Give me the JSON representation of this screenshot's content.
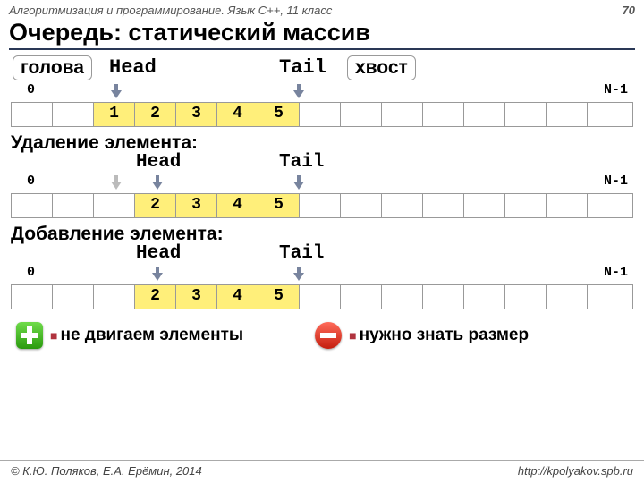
{
  "header": {
    "course": "Алгоритмизация и программирование. Язык C++, 11 класс",
    "page": "70"
  },
  "title": "Очередь: статический массив",
  "labels": {
    "head_ru": "голова",
    "head": "Head",
    "tail": "Tail",
    "tail_ru": "хвост",
    "zero": "0",
    "n1": "N-1"
  },
  "sections": {
    "del": "Удаление элемента:",
    "add": "Добавление элемента:"
  },
  "arrays": {
    "a1": [
      "",
      "",
      "1",
      "2",
      "3",
      "4",
      "5",
      "",
      "",
      "",
      "",
      "",
      "",
      "",
      ""
    ],
    "a2": [
      "",
      "",
      "",
      "2",
      "3",
      "4",
      "5",
      "",
      "",
      "",
      "",
      "",
      "",
      "",
      ""
    ],
    "a3": [
      "",
      "",
      "",
      "2",
      "3",
      "4",
      "5",
      "",
      "",
      "",
      "",
      "",
      "",
      "",
      ""
    ]
  },
  "bullets": {
    "pro": "не двигаем элементы",
    "con": "нужно знать размер"
  },
  "footer": {
    "copy": "© К.Ю. Поляков, Е.А. Ерёмин, 2014",
    "url": "http://kpolyakov.spb.ru"
  }
}
